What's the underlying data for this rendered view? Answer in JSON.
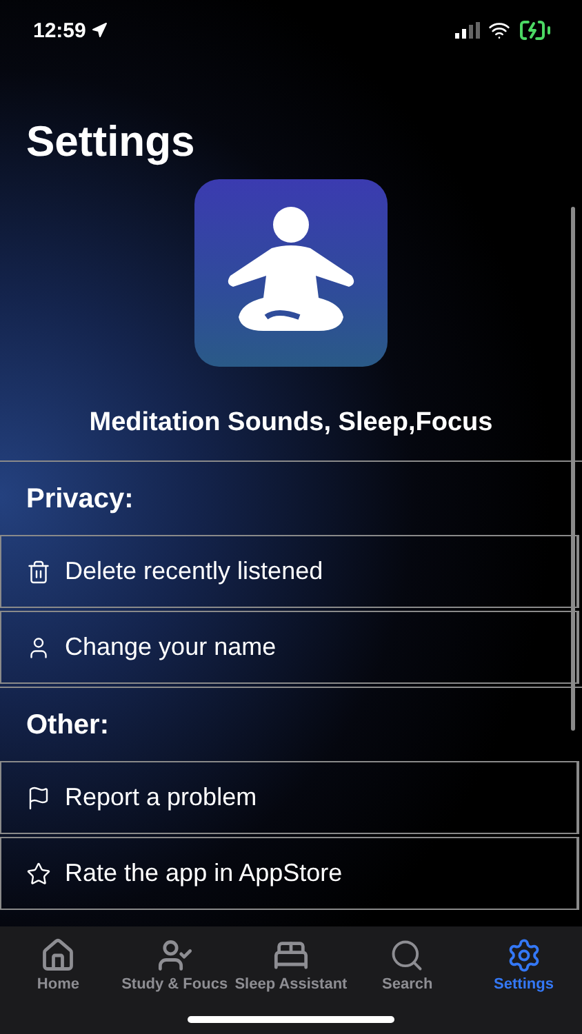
{
  "status_bar": {
    "time": "12:59"
  },
  "title": "Settings",
  "app_name": "Meditation Sounds, Sleep,Focus",
  "sections": [
    {
      "header": "Privacy:",
      "items": [
        {
          "label": "Delete recently listened",
          "kind": "trash"
        },
        {
          "label": "Change your name",
          "kind": "person"
        }
      ]
    },
    {
      "header": "Other:",
      "items": [
        {
          "label": "Report a problem",
          "kind": "flag"
        },
        {
          "label": "Rate the app in AppStore",
          "kind": "star"
        }
      ]
    }
  ],
  "tab_bar": [
    {
      "label": "Home",
      "kind": "home",
      "selected": false
    },
    {
      "label": "Study & Foucs",
      "kind": "study",
      "selected": false
    },
    {
      "label": "Sleep Assistant",
      "kind": "sleep",
      "selected": false
    },
    {
      "label": "Search",
      "kind": "search",
      "selected": false
    },
    {
      "label": "Settings",
      "kind": "settings",
      "selected": true
    }
  ]
}
